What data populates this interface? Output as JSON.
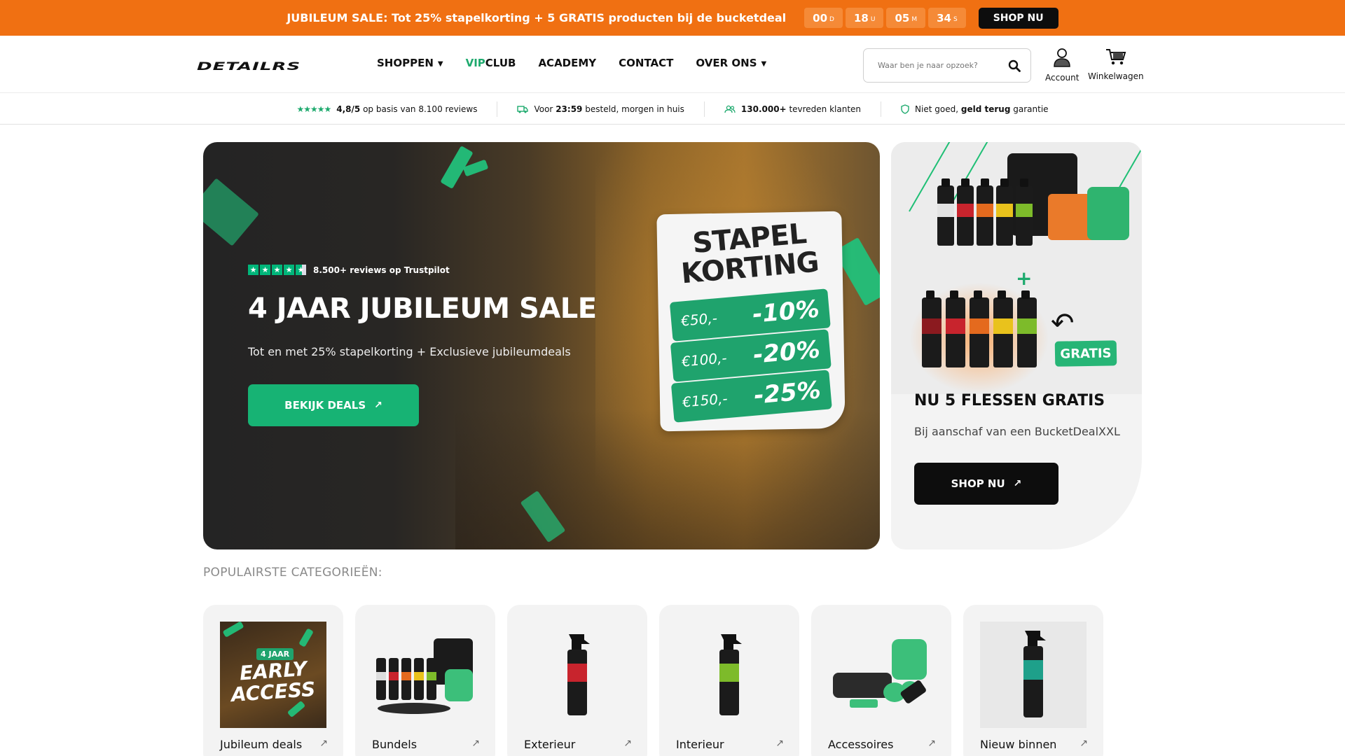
{
  "announcement": {
    "text": "JUBILEUM SALE: Tot 25% stapelkorting + 5 GRATIS producten bij de bucketdeal",
    "countdown": [
      {
        "value": "00",
        "unit": "D"
      },
      {
        "value": "18",
        "unit": "U"
      },
      {
        "value": "05",
        "unit": "M"
      },
      {
        "value": "34",
        "unit": "S"
      }
    ],
    "button_label": "SHOP NU"
  },
  "header": {
    "logo_text": "DETAILRS",
    "nav": {
      "shoppen": "SHOPPEN",
      "vip_accent": "VIP",
      "vip_rest": "CLUB",
      "academy": "ACADEMY",
      "contact": "CONTACT",
      "over_ons": "OVER ONS"
    },
    "search_placeholder": "Waar ben je naar opzoek?",
    "account_label": "Account",
    "cart_label": "Winkelwagen"
  },
  "usp": {
    "rating_bold": "4,8/5",
    "rating_rest": "op basis van 8.100 reviews",
    "delivery_pre": "Voor",
    "delivery_bold": "23:59",
    "delivery_rest": "besteld, morgen in huis",
    "customers_bold": "130.000+",
    "customers_rest": "tevreden klanten",
    "guarantee_pre": "Niet goed,",
    "guarantee_bold": "geld terug",
    "guarantee_rest": "garantie"
  },
  "hero": {
    "trustpilot_text": "8.500+ reviews op Trustpilot",
    "title": "4 JAAR JUBILEUM SALE",
    "subtitle": "Tot en met 25% stapelkorting + Exclusieve jubileumdeals",
    "button_label": "BEKIJK DEALS",
    "badge_line1": "STAPEL",
    "badge_line2": "KORTING",
    "tiers": [
      {
        "amount": "€50,-",
        "discount": "-10%"
      },
      {
        "amount": "€100,-",
        "discount": "-20%"
      },
      {
        "amount": "€150,-",
        "discount": "-25%"
      }
    ]
  },
  "side_promo": {
    "gratis_label": "GRATIS",
    "title": "NU 5 FLESSEN GRATIS",
    "subtitle": "Bij aanschaf van een BucketDealXXL",
    "button_label": "SHOP NU"
  },
  "categories": {
    "heading": "POPULAIRSTE CATEGORIEËN:",
    "early_access_badge": "4 JAAR",
    "early_access_line1": "EARLY",
    "early_access_line2": "ACCESS",
    "items": [
      {
        "label": "Jubileum deals"
      },
      {
        "label": "Bundels"
      },
      {
        "label": "Exterieur"
      },
      {
        "label": "Interieur"
      },
      {
        "label": "Accessoires"
      },
      {
        "label": "Nieuw binnen"
      }
    ]
  },
  "colors": {
    "announcement_bg": "#f07012",
    "brand_green": "#17b374",
    "dark": "#0d0d0d"
  }
}
